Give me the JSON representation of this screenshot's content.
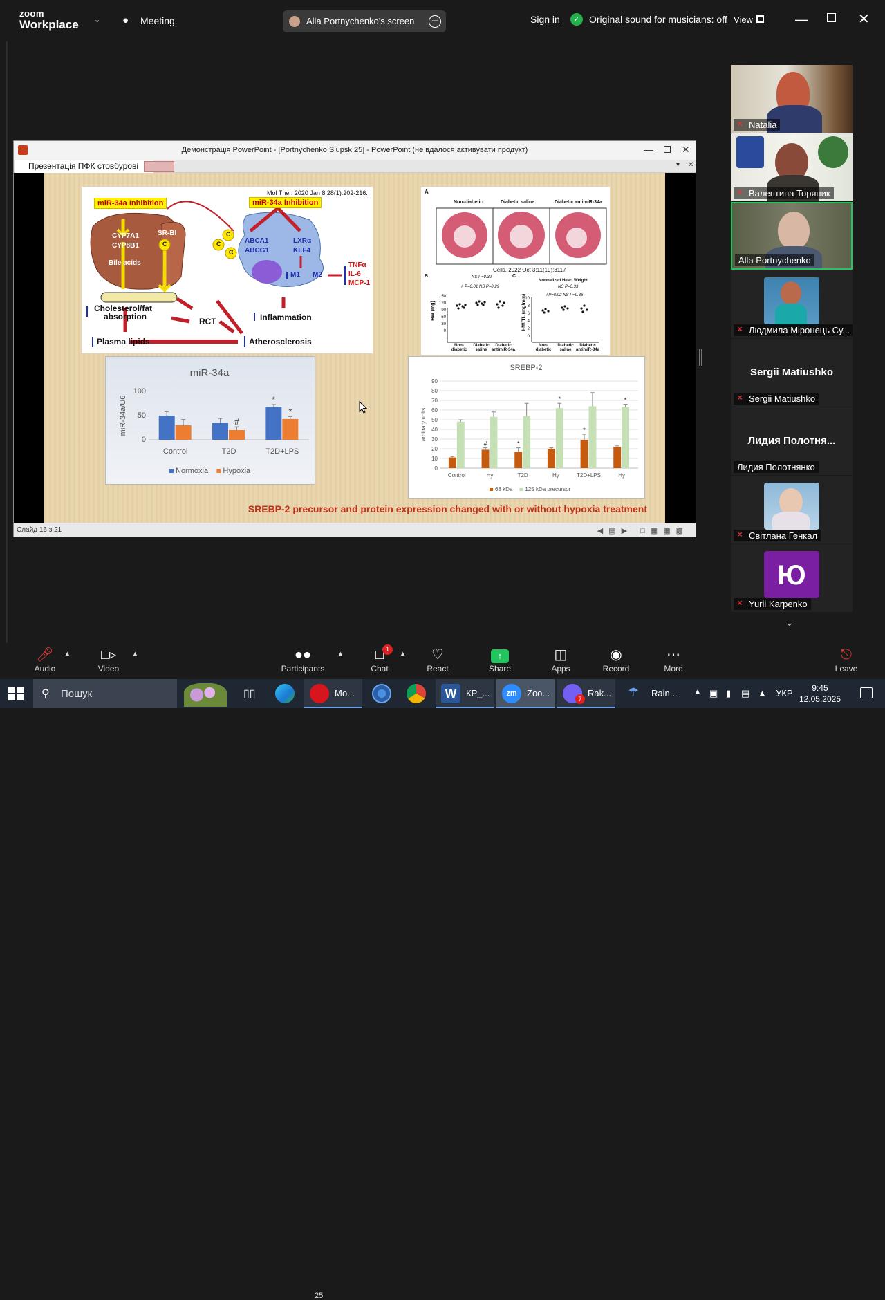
{
  "zoom": {
    "logo_line1": "zoom",
    "logo_line2": "Workplace",
    "meeting_label": "Meeting",
    "screen_share_label": "Alla Portnychenko's screen",
    "sign_in": "Sign in",
    "original_sound": "Original sound for musicians: off",
    "view_label": "View"
  },
  "ppt": {
    "window_title": "Демонстрація PowerPoint - [Portnychenko Slupsk 25] - PowerPoint (не вдалося активувати продукт)",
    "tab_title": "Презентація ПФК стовбурові",
    "slide_counter": "Слайд 16 з 21",
    "slide": {
      "caption": "SREBP-2 precursor and protein expression changed with or without hypoxia treatment",
      "diagram": {
        "citation": "Mol Ther. 2020 Jan 8;28(1):202-216.",
        "inhibition_left": "miR-34a Inhibition",
        "inhibition_right": "miR-34a Inhibition",
        "cyp7a1": "CYP7A1",
        "cyp8b1": "CYP8B1",
        "bile_acids": "Bile acids",
        "srbi": "SR-BI",
        "abca1": "ABCA1",
        "abcg1": "ABCG1",
        "lxr": "LXRα",
        "klf4": "KLF4",
        "m1": "M1",
        "m2": "M2",
        "tnf": "TNFα",
        "il6": "IL-6",
        "mcp1": "MCP-1",
        "chol": "Cholesterol/fat",
        "absorption": "absorption",
        "rct": "RCT",
        "inflammation": "Inflammation",
        "plasma": "Plasma lipids",
        "athero": "Atherosclerosis",
        "c": "C"
      },
      "histology": {
        "panel_a": "A",
        "panel_b": "B",
        "panel_c": "C",
        "col1": "Non-diabetic",
        "col2": "Diabetic saline",
        "col3": "Diabetic antimiR-34a",
        "citation": "Cells. 2022 Oct 3;11(19):3117",
        "chart_b_ylabel": "HW (mg)",
        "chart_c_title": "Normalized Heart Weight",
        "chart_c_ylabel": "HW/TL (mg/mm)",
        "ns_b": "NS P=0.32",
        "p_b": "# P=0.01   NS P=0.29",
        "ns_c": "NS P=0.33",
        "p_c": "#P=0.02   NS P=0.36",
        "x1": "Non-diabetic",
        "x2": "Diabetic saline",
        "x3": "Diabetic antimiR-34a",
        "b_ticks": [
          "150",
          "120",
          "90",
          "60",
          "30",
          "0"
        ],
        "c_ticks": [
          "10",
          "8",
          "6",
          "4",
          "2",
          "0"
        ]
      }
    }
  },
  "chart_data": [
    {
      "type": "bar",
      "title": "miR-34a",
      "ylabel": "miR-34a/U6",
      "ylim": [
        0,
        100
      ],
      "yticks": [
        "100",
        "50",
        "0"
      ],
      "categories": [
        "Control",
        "T2D",
        "T2D+LPS"
      ],
      "series": [
        {
          "name": "Normoxia",
          "color": "#4472c4",
          "values": [
            50,
            35,
            68
          ],
          "errors": [
            8,
            9,
            5
          ]
        },
        {
          "name": "Hypoxia",
          "color": "#ed7d31",
          "values": [
            30,
            20,
            43
          ],
          "errors": [
            12,
            7,
            5
          ]
        }
      ],
      "annotations": [
        {
          "category": "T2D",
          "series": "Hypoxia",
          "text": "#"
        },
        {
          "category": "T2D+LPS",
          "series": "Normoxia",
          "text": "*"
        },
        {
          "category": "T2D+LPS",
          "series": "Hypoxia",
          "text": "*"
        }
      ],
      "legend": "bottom"
    },
    {
      "type": "bar",
      "title": "SREBP-2",
      "ylabel": "arbitrary units",
      "ylim": [
        0,
        90
      ],
      "yticks": [
        "90",
        "80",
        "70",
        "60",
        "50",
        "40",
        "30",
        "20",
        "10",
        "0"
      ],
      "categories": [
        "Control",
        "Hy",
        "T2D",
        "Hy",
        "T2D+LPS",
        "Hy"
      ],
      "series": [
        {
          "name": "68 kDa",
          "color": "#c55a11",
          "values": [
            11,
            19,
            17,
            20,
            29,
            22
          ],
          "errors": [
            1,
            2,
            4,
            1,
            6,
            1
          ]
        },
        {
          "name": "125 kDa precursor",
          "color": "#c5e0b4",
          "values": [
            48,
            53,
            54,
            62,
            64,
            63
          ],
          "errors": [
            2,
            5,
            13,
            5,
            14,
            3
          ]
        }
      ],
      "annotations": [
        {
          "category_index": 1,
          "series": "68 kDa",
          "text": "#"
        },
        {
          "category_index": 2,
          "series": "68 kDa",
          "text": "*"
        },
        {
          "category_index": 3,
          "series": "125 kDa precursor",
          "text": "*"
        },
        {
          "category_index": 4,
          "series": "68 kDa",
          "text": "*"
        },
        {
          "category_index": 5,
          "series": "125 kDa precursor",
          "text": "*"
        }
      ],
      "legend": "bottom"
    }
  ],
  "participants": [
    {
      "name": "Natalia",
      "muted": true,
      "video_color": "#b8a98f"
    },
    {
      "name": "Валентина Торяник",
      "muted": true,
      "video_color": "#8e8a7a"
    },
    {
      "name": "Alla Portnychenko",
      "muted": false,
      "video_color": "#6c6f5a",
      "active": true
    },
    {
      "name": "Людмила Міронець Су...",
      "muted": true,
      "video_color": "#3d7aa6"
    },
    {
      "name": "Sergii Matiushko",
      "muted": true,
      "big_name": "Sergii Matiushko"
    },
    {
      "name": "Лидия Полотнянко",
      "muted": false,
      "big_name": "Лидия  Полотня..."
    },
    {
      "name": "Світлана Генкал",
      "muted": true,
      "video_color": "#8fb8d8"
    },
    {
      "name": "Yurii Karpenko",
      "muted": true,
      "avatar_letter": "Ю",
      "avatar_color": "#7b1fa2"
    }
  ],
  "toolbar": {
    "audio": "Audio",
    "video": "Video",
    "participants": "Participants",
    "participants_count": "25",
    "chat": "Chat",
    "chat_badge": "1",
    "react": "React",
    "share": "Share",
    "apps": "Apps",
    "record": "Record",
    "more": "More",
    "leave": "Leave"
  },
  "taskbar": {
    "search_placeholder": "Пошук",
    "apps": [
      {
        "label": "Мо...",
        "color": "#d8151d"
      },
      {
        "label": "КР_...",
        "color": "#2b579a"
      },
      {
        "label": "Zoo...",
        "color": "#2d8cff"
      },
      {
        "label": "Rak...",
        "color": "#7360f2",
        "badge": "7"
      },
      {
        "label": "Rain...",
        "color": "#6aa0e8"
      }
    ],
    "language": "УКР",
    "time": "9:45",
    "date": "12.05.2025"
  }
}
